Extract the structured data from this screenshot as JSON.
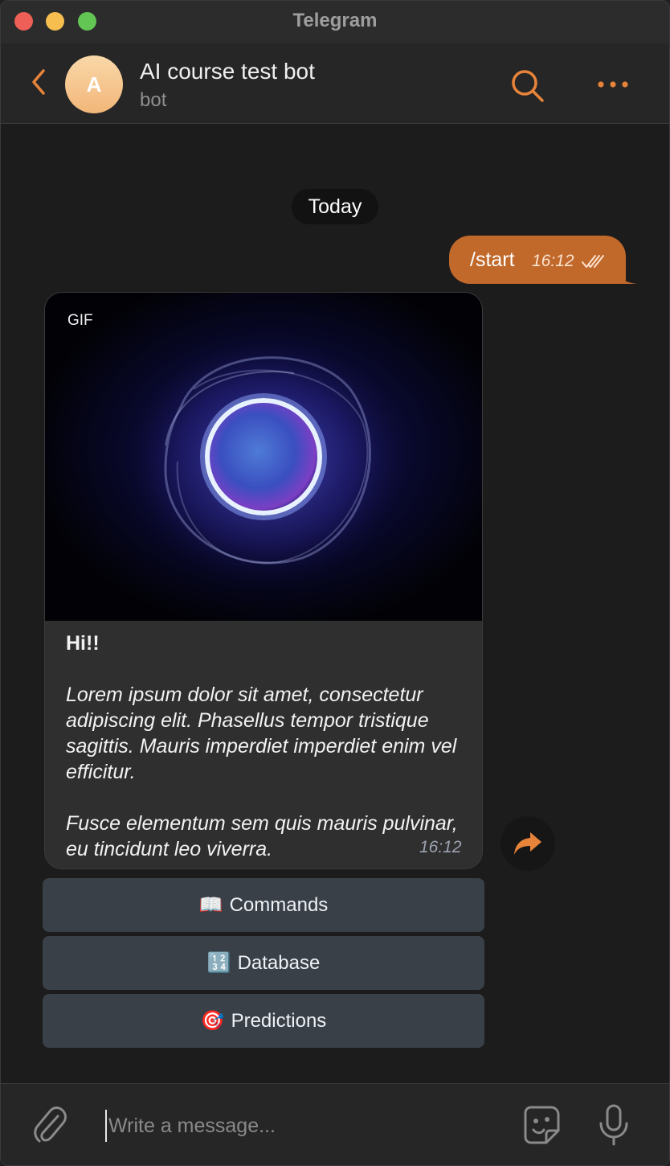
{
  "app": {
    "title": "Telegram"
  },
  "header": {
    "avatar_initial": "A",
    "chat_name": "AI course test bot",
    "chat_status": "bot"
  },
  "messages": {
    "date_separator": "Today",
    "outgoing": {
      "text": "/start",
      "time": "16:12"
    },
    "incoming": {
      "media_badge": "GIF",
      "bold_text": "Hi!!",
      "paragraph1": "Lorem ipsum dolor sit amet, consectetur adipiscing elit. Phasellus tempor tristique sagittis. Mauris imperdiet imperdiet enim vel efficitur.",
      "paragraph2": "Fusce elementum sem quis mauris pulvinar, eu tincidunt leo viverra.",
      "time": "16:12"
    }
  },
  "inline_keyboard": [
    {
      "emoji": "📖",
      "label": "Commands"
    },
    {
      "emoji": "🔢",
      "label": "Database"
    },
    {
      "emoji": "🎯",
      "label": "Predictions"
    }
  ],
  "composer": {
    "placeholder": "Write a message..."
  },
  "colors": {
    "accent": "#e8843a",
    "outgoing_bubble": "#c0692b",
    "incoming_bubble": "#2f2f2f",
    "keyboard_button": "#3a4048"
  },
  "icons": {
    "back": "chevron-left-icon",
    "search": "search-icon",
    "more": "more-dots-icon",
    "share": "share-arrow-icon",
    "attach": "paperclip-icon",
    "sticker": "sticker-icon",
    "mic": "microphone-icon",
    "read": "double-check-icon"
  }
}
